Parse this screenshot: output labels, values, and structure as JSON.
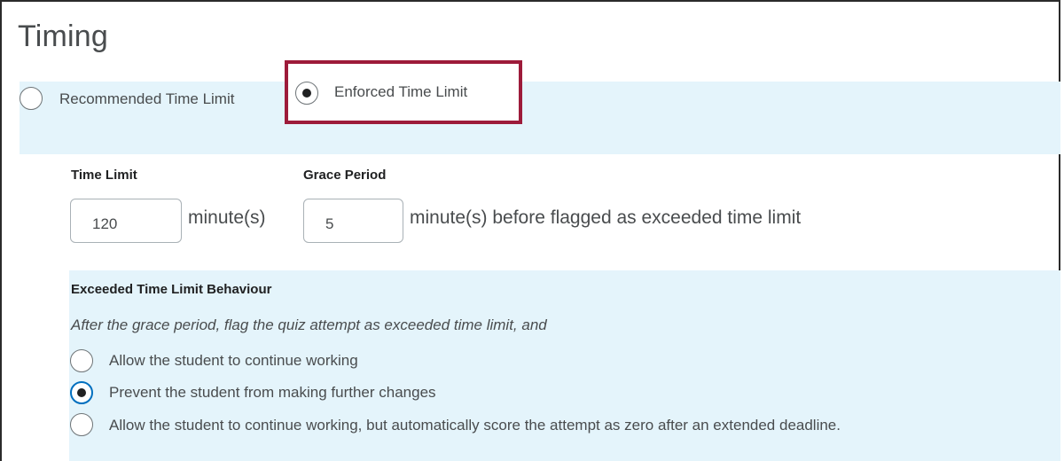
{
  "section": {
    "title": "Timing"
  },
  "time_limit_mode": {
    "options": [
      {
        "label": "Recommended Time Limit",
        "selected": false
      },
      {
        "label": "Enforced Time Limit",
        "selected": true
      }
    ]
  },
  "time_limit": {
    "label": "Time Limit",
    "value": "120",
    "unit": "minute(s)"
  },
  "grace_period": {
    "label": "Grace Period",
    "value": "5",
    "unit": "minute(s) before flagged as exceeded time limit"
  },
  "exceeded_behaviour": {
    "heading": "Exceeded Time Limit Behaviour",
    "description": "After the grace period, flag the quiz attempt as exceeded time limit, and",
    "options": [
      {
        "label": "Allow the student to continue working",
        "selected": false
      },
      {
        "label": "Prevent the student from making further changes",
        "selected": true
      },
      {
        "label": "Allow the student to continue working, but automatically score the attempt as zero after an extended deadline.",
        "selected": false
      }
    ]
  },
  "colors": {
    "band": "#e4f4fb",
    "highlight": "#9d1b3a",
    "focus": "#006fbf"
  }
}
